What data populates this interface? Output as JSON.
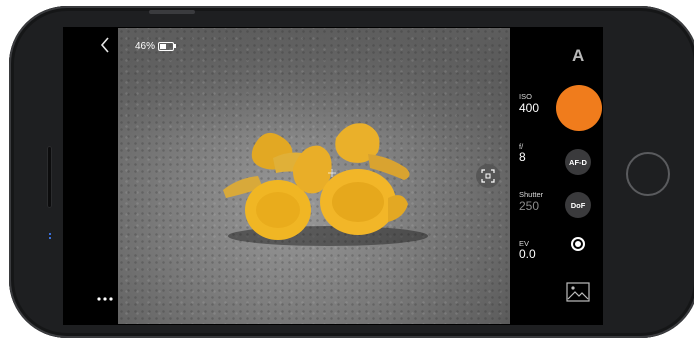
{
  "status": {
    "battery_percent": "46%",
    "battery_level": 0.46
  },
  "controls": {
    "back_icon": "chevron-left-icon",
    "mode": "A",
    "iso": {
      "label": "ISO",
      "value": "400"
    },
    "aperture": {
      "label": "f/",
      "value": "8"
    },
    "shutter": {
      "label": "Shutter",
      "value": "250"
    },
    "ev": {
      "label": "EV",
      "value": "0.0"
    },
    "af_button": "AF-D",
    "dof_button": "DoF",
    "more_icon": "ellipsis-icon",
    "gallery_icon": "image-icon",
    "focus_icon": "focus-frame-icon"
  },
  "colors": {
    "shutter_accent": "#f07c1c"
  }
}
